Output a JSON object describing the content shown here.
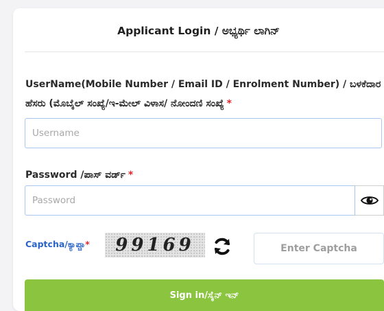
{
  "login": {
    "title": "Applicant Login / ಅಭ್ಯರ್ಥಿ ಲಾಗಿನ್",
    "username_label_line1": "UserName(Mobile Number / Email ID / Enrolment Number) / ಬಳಕೆದಾರ",
    "username_label_line2": "ಹೆಸರು (ಮೊಬೈಲ್ ಸಂಖ್ಯೆ/ಇ-ಮೇಲ್ ವಿಳಾಸ/ ನೋಂದಣಿ ಸಂಖ್ಯೆ",
    "username_placeholder": "Username",
    "username_value": "",
    "password_label": "Password /ಪಾಸ್ ವರ್ಡ್",
    "password_placeholder": "Password",
    "password_value": "",
    "required_mark": "*",
    "captcha_label": "Captcha/ಕ್ಯಾಪ್ಚಾ",
    "captcha_code": "99169",
    "captcha_placeholder": "Enter Captcha",
    "captcha_value": "",
    "signin_label": "Sign in/ಸೈನ್ ಇನ್",
    "icons": {
      "show_password": "eye-icon",
      "refresh_captcha": "refresh-icon"
    },
    "colors": {
      "accent_green": "#8bc53f",
      "required_red": "#e5252a",
      "captcha_label_blue": "#2a64c8"
    }
  }
}
